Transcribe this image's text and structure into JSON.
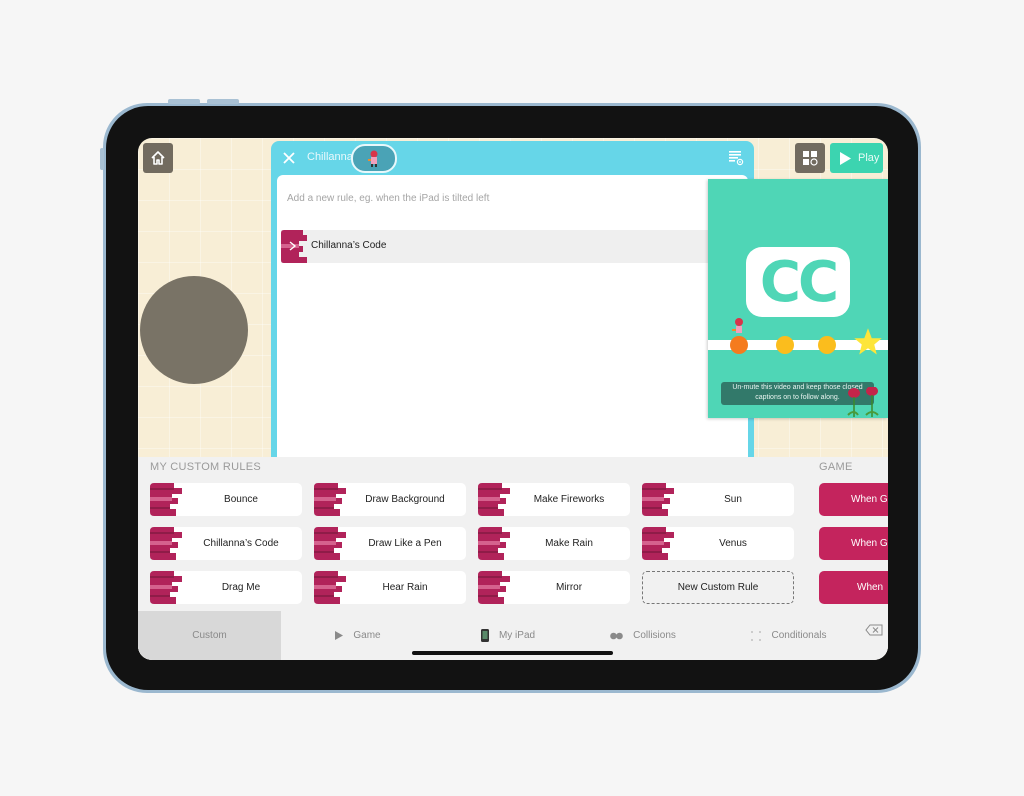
{
  "editor": {
    "character_name": "Chillanna",
    "add_rule_placeholder": "Add a new rule, eg. when the iPad is tilted left",
    "rules": [
      {
        "label": "Chillanna’s Code"
      }
    ]
  },
  "toolbar": {
    "play_label": "Play"
  },
  "video": {
    "caption": "Un-mute this video and keep those closed captions on to follow along.",
    "badge": "CC"
  },
  "custom_rules": {
    "title": "MY CUSTOM RULES",
    "items": [
      {
        "label": "Bounce"
      },
      {
        "label": "Chillanna’s Code"
      },
      {
        "label": "Drag Me"
      },
      {
        "label": "Draw Background"
      },
      {
        "label": "Draw Like a Pen"
      },
      {
        "label": "Hear Rain"
      },
      {
        "label": "Make Fireworks"
      },
      {
        "label": "Make Rain"
      },
      {
        "label": "Mirror"
      },
      {
        "label": "Sun"
      },
      {
        "label": "Venus"
      }
    ],
    "new_rule_label": "New Custom Rule"
  },
  "game_rules": {
    "title": "GAME",
    "items": [
      {
        "label": "When Game"
      },
      {
        "label": "When Game"
      },
      {
        "label": "When"
      }
    ]
  },
  "tabs": [
    {
      "label": "Custom",
      "icon": "none",
      "active": true
    },
    {
      "label": "Game",
      "icon": "play-icon",
      "active": false
    },
    {
      "label": "My iPad",
      "icon": "ipad-icon",
      "active": false
    },
    {
      "label": "Collisions",
      "icon": "collisions-icon",
      "active": false
    },
    {
      "label": "Conditionals",
      "icon": "conditionals-icon",
      "active": false
    }
  ],
  "colors": {
    "accent_teal": "#3cd4b0",
    "editor_blue": "#66d6e8",
    "rule_magenta": "#c4245d",
    "canvas_cream": "#f8eed6"
  }
}
